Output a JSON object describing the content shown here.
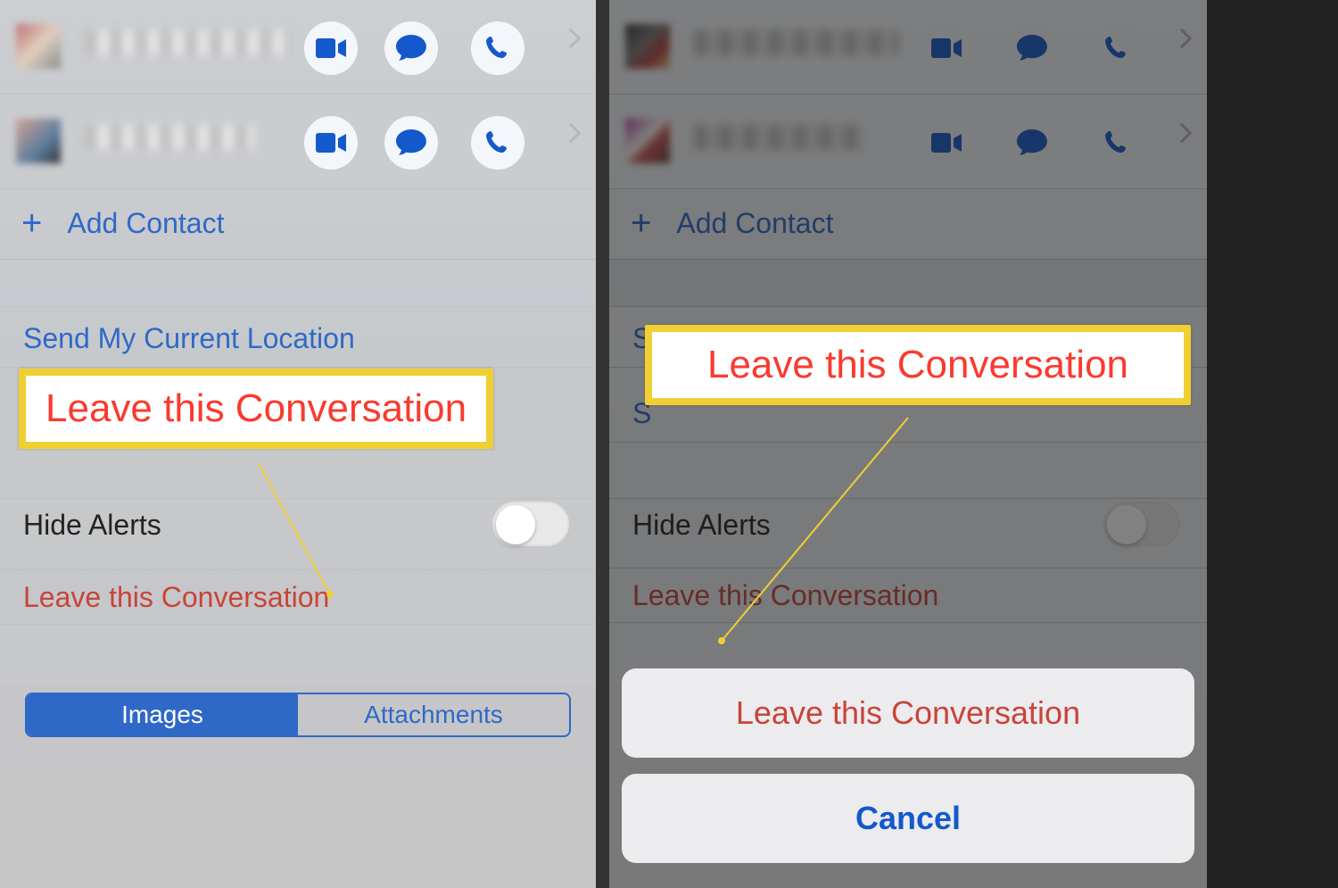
{
  "left": {
    "addContact": "Add Contact",
    "sendLocation": "Send My Current Location",
    "hideAlerts": "Hide Alerts",
    "leave": "Leave this Conversation",
    "segments": {
      "images": "Images",
      "attachments": "Attachments"
    },
    "callout": "Leave this Conversation"
  },
  "right": {
    "addContact": "Add Contact",
    "sendLocationInitial": "S",
    "shareMyInitial": "S",
    "hideAlerts": "Hide Alerts",
    "leaveRow": "Leave this Conversation",
    "callout": "Leave this Conversation",
    "sheet": {
      "leave": "Leave this Conversation",
      "cancel": "Cancel"
    }
  },
  "icons": {
    "video": "video-icon",
    "message": "message-icon",
    "call": "phone-icon",
    "chevron": "chevron-right-icon",
    "plus": "plus-icon"
  }
}
